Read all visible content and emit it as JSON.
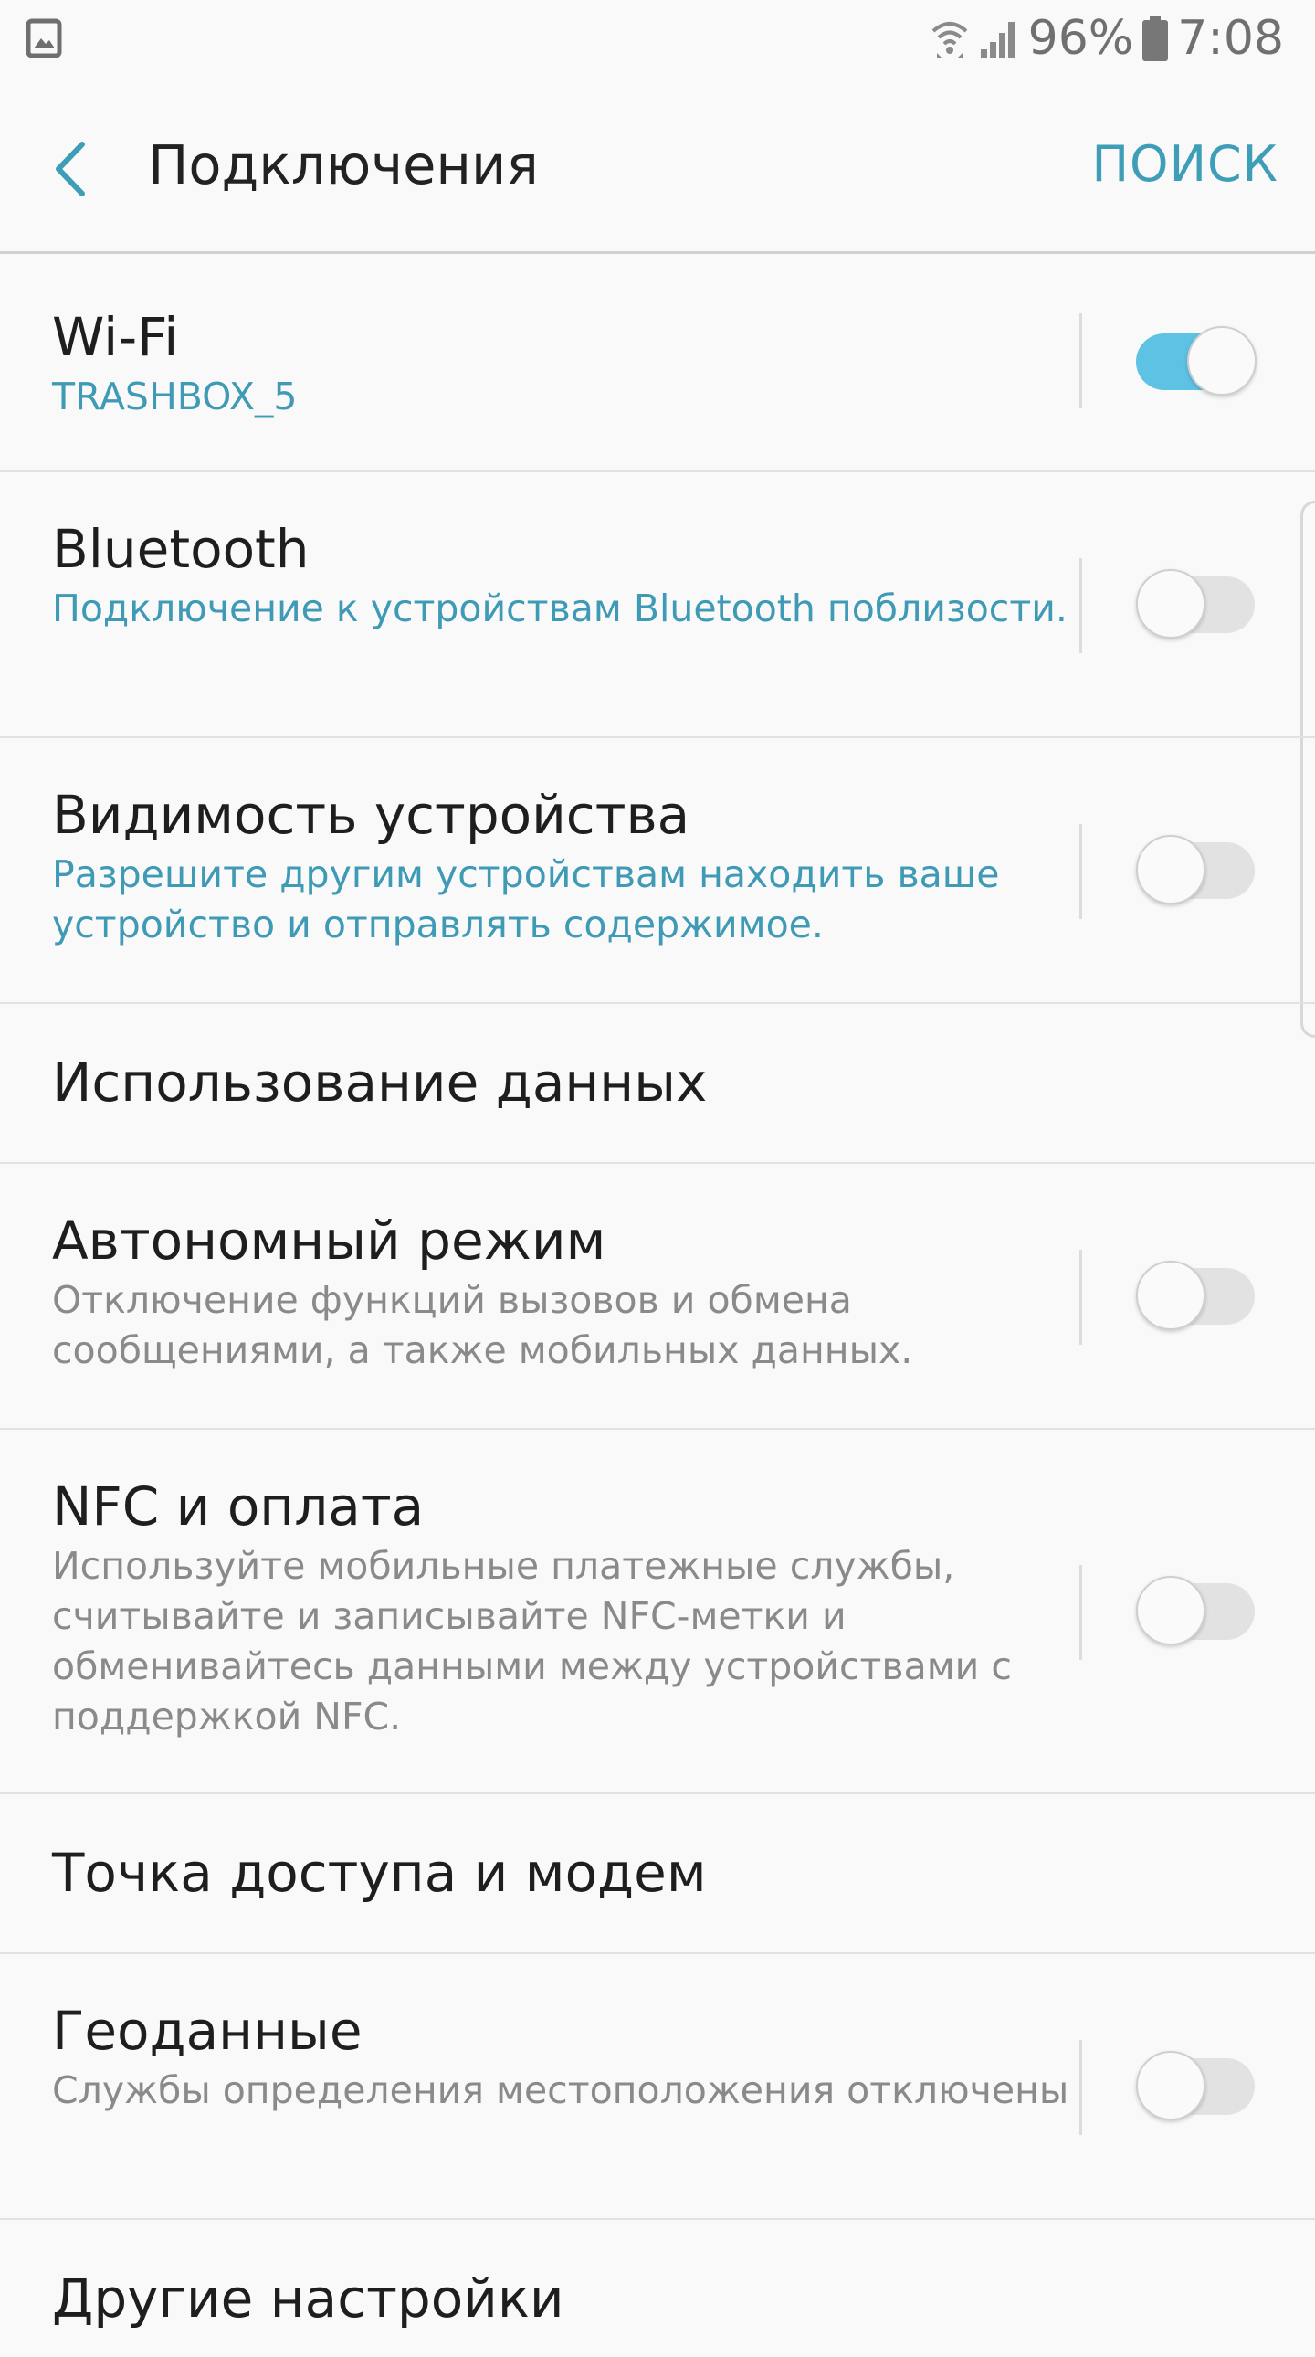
{
  "status_bar": {
    "battery": "96%",
    "time": "7:08",
    "icons": [
      "gallery-icon",
      "wifi-icon",
      "signal-icon",
      "battery-icon"
    ]
  },
  "header": {
    "title": "Подключения",
    "search_label": "ПОИСК",
    "back_icon": "chevron-left-icon"
  },
  "colors": {
    "accent": "#3e9ab5",
    "toggle_on": "#5ec2e5",
    "background": "#f9f9f9"
  },
  "settings": [
    {
      "title": "Wi-Fi",
      "subtitle": "TRASHBOX_5",
      "subtitle_style": "blue",
      "toggle": true
    },
    {
      "title": "Bluetooth",
      "subtitle": "Подключение к устройствам Bluetooth поблизости.",
      "subtitle_style": "blue",
      "toggle": false
    },
    {
      "title": "Видимость устройства",
      "subtitle": "Разрешите другим устройствам находить ваше устройство и отправлять содержимое.",
      "subtitle_style": "blue",
      "toggle": false
    },
    {
      "title": "Использование данных"
    },
    {
      "title": "Автономный режим",
      "subtitle": "Отключение функций вызовов и обмена сообщениями, а также мобильных данных.",
      "subtitle_style": "gray",
      "toggle": false
    },
    {
      "title": "NFC и оплата",
      "subtitle": "Используйте мобильные платежные службы, считывайте и записывайте NFC-метки и обменивайтесь данными между устройствами с поддержкой NFC.",
      "subtitle_style": "gray",
      "toggle": false
    },
    {
      "title": "Точка доступа и модем"
    },
    {
      "title": "Геоданные",
      "subtitle": "Службы определения местоположения отключены",
      "subtitle_style": "gray",
      "toggle": false
    },
    {
      "title": "Другие настройки"
    }
  ]
}
